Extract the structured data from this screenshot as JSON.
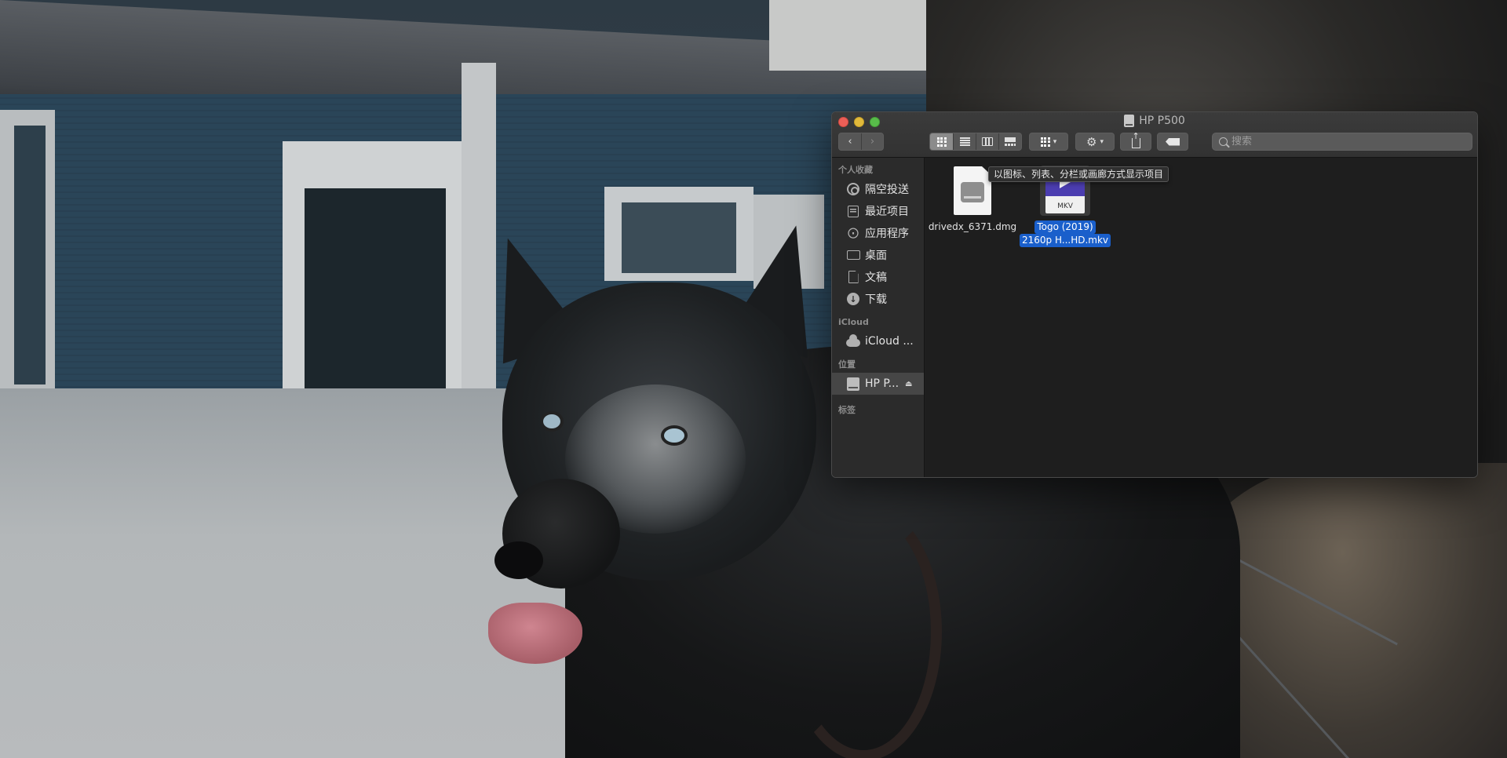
{
  "window": {
    "title": "HP P500",
    "title_icon": "external-drive-icon"
  },
  "toolbar": {
    "back_icon": "chevron-left-icon",
    "forward_icon": "chevron-right-icon",
    "view_modes": [
      "icon",
      "list",
      "columns",
      "gallery"
    ],
    "selected_view": "icon",
    "search_placeholder": "搜索",
    "tooltip": "以图标、列表、分栏或画廊方式显示项目"
  },
  "sidebar": {
    "sections": [
      {
        "title": "个人收藏",
        "items": [
          {
            "label": "隔空投送",
            "icon": "airdrop-icon"
          },
          {
            "label": "最近项目",
            "icon": "recents-icon"
          },
          {
            "label": "应用程序",
            "icon": "applications-icon"
          },
          {
            "label": "桌面",
            "icon": "desktop-icon"
          },
          {
            "label": "文稿",
            "icon": "documents-icon"
          },
          {
            "label": "下载",
            "icon": "downloads-icon"
          }
        ]
      },
      {
        "title": "iCloud",
        "items": [
          {
            "label": "iCloud ...",
            "icon": "icloud-icon"
          }
        ]
      },
      {
        "title": "位置",
        "items": [
          {
            "label": "HP P...",
            "icon": "external-drive-icon",
            "selected": true,
            "eject": "⏏"
          }
        ]
      },
      {
        "title": "标签",
        "items": []
      }
    ]
  },
  "files": [
    {
      "name": "drivedx_6371.dmg",
      "type": "dmg",
      "selected": false
    },
    {
      "name_line1": "Togo (2019)",
      "name_line2": "2160p H...HD.mkv",
      "type": "mkv",
      "badge": "MKV",
      "selected": true
    }
  ],
  "colors": {
    "selection": "#1a5fcb",
    "close": "#ec5f57",
    "minimize": "#e1b93b",
    "zoom": "#58bc4a"
  }
}
